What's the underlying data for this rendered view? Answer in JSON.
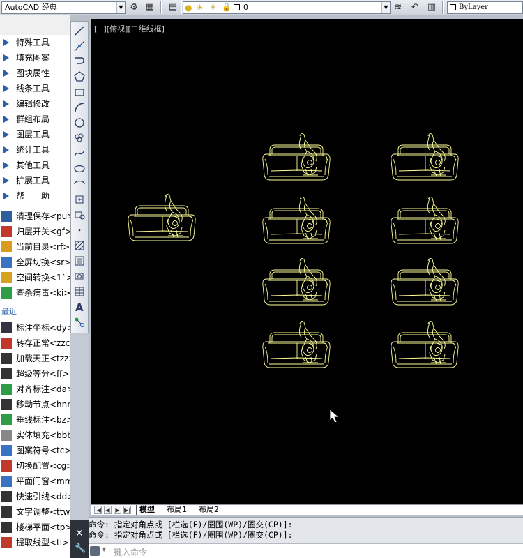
{
  "toolbar": {
    "workspace": "AutoCAD 经典",
    "layer": "0",
    "linetype": "ByLayer"
  },
  "palette": {
    "categories": [
      "特殊工具",
      "填充图案",
      "图块属性",
      "线条工具",
      "编辑修改",
      "群组布局",
      "图层工具",
      "统计工具",
      "其他工具",
      "扩展工具",
      "帮　　助"
    ],
    "commands": [
      {
        "label": "清理保存<pu>",
        "icon": "save-icon",
        "color": "#2f5e9e"
      },
      {
        "label": "归层开关<gf>",
        "icon": "layer-toggle-icon",
        "color": "#c0392b"
      },
      {
        "label": "当前目录<rf>",
        "icon": "folder-icon",
        "color": "#d79b1f"
      },
      {
        "label": "全屏切换<sr>",
        "icon": "fullscreen-icon",
        "color": "#3a73c4"
      },
      {
        "label": "空间转换<1`>",
        "icon": "space-convert-icon",
        "color": "#d7a21f"
      },
      {
        "label": "查杀病毒<ki>",
        "icon": "shield-icon",
        "color": "#2e9e46"
      }
    ],
    "recent_label": "最近",
    "recent": [
      {
        "label": "标注坐标<dy>",
        "icon": "coordinate-icon",
        "color": "#334"
      },
      {
        "label": "转存正常<zzc>",
        "icon": "convert-icon",
        "color": "#c0392b"
      },
      {
        "label": "加载天正<tzz>",
        "icon": "load-icon",
        "color": "#333"
      },
      {
        "label": "超级等分<ff>",
        "icon": "divide-icon",
        "color": "#333"
      },
      {
        "label": "对齐标注<da>",
        "icon": "align-dim-icon",
        "color": "#2e9e46"
      },
      {
        "label": "移动节点<hnn>",
        "icon": "node-icon",
        "color": "#333"
      },
      {
        "label": "垂线标注<bz>",
        "icon": "grid-icon",
        "color": "#2e9e46"
      },
      {
        "label": "实体填充<bbb>",
        "icon": "fill-icon",
        "color": "#888"
      },
      {
        "label": "图案符号<tc>",
        "icon": "pattern-icon",
        "color": "#3a73c4"
      },
      {
        "label": "切换配置<cg>",
        "icon": "config-icon",
        "color": "#c0392b"
      },
      {
        "label": "平面门窗<mm>",
        "icon": "door-icon",
        "color": "#3a73c4"
      },
      {
        "label": "快速引线<dd>",
        "icon": "leader-icon",
        "color": "#333"
      },
      {
        "label": "文字调整<ttw>",
        "icon": "text-adjust-icon",
        "color": "#333"
      },
      {
        "label": "楼梯平面<tp>",
        "icon": "stair-icon",
        "color": "#333"
      },
      {
        "label": "提取线型<tl>",
        "icon": "linetype-icon",
        "color": "#c0392b"
      }
    ]
  },
  "viewport": {
    "label": "[−][俯视][二维线框]"
  },
  "layout_tabs": [
    "模型",
    "布局1",
    "布局2"
  ],
  "command": {
    "history": [
      "命令: 指定对角点或 [栏选(F)/圈围(WP)/圈交(CP)]:",
      "命令: 指定对角点或 [栏选(F)/圈围(WP)/圈交(CP)]:"
    ],
    "placeholder": "键入命令"
  },
  "colors": {
    "canvas": "#000000",
    "entity": "#ffff99"
  }
}
